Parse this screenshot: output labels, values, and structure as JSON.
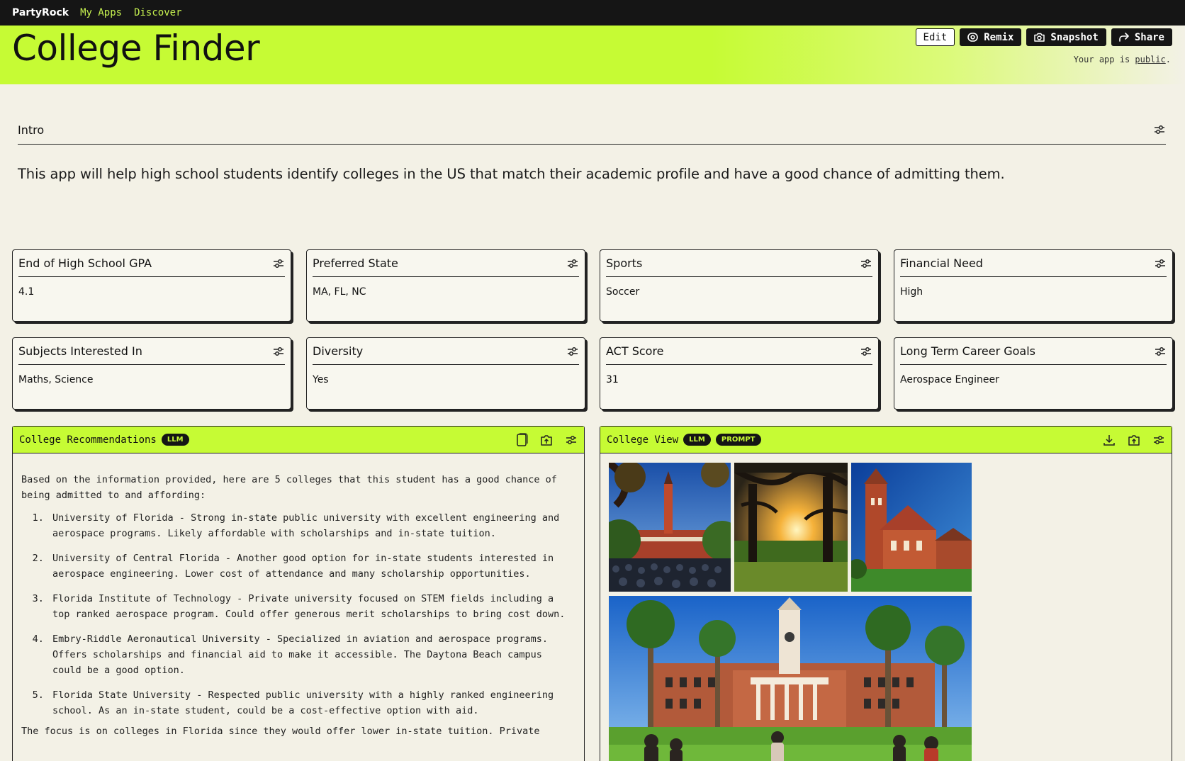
{
  "nav": {
    "brand": "PartyRock",
    "links": [
      "My Apps",
      "Discover"
    ]
  },
  "header": {
    "title": "College Finder",
    "actions": {
      "edit": "Edit",
      "remix": "Remix",
      "snapshot": "Snapshot",
      "share": "Share"
    },
    "public_prefix": "Your app is ",
    "public_link": "public",
    "public_suffix": "."
  },
  "intro": {
    "label": "Intro",
    "text": "This app will help high school students identify colleges in the US that match their academic profile and have a good chance of admitting them."
  },
  "inputs": [
    {
      "label": "End of High School GPA",
      "value": "4.1"
    },
    {
      "label": "Preferred State",
      "value": "MA, FL, NC"
    },
    {
      "label": "Sports",
      "value": "Soccer"
    },
    {
      "label": "Financial Need",
      "value": "High"
    },
    {
      "label": "Subjects Interested In",
      "value": "Maths, Science"
    },
    {
      "label": "Diversity",
      "value": "Yes"
    },
    {
      "label": "ACT Score",
      "value": "31"
    },
    {
      "label": "Long Term Career Goals",
      "value": "Aerospace Engineer"
    }
  ],
  "recommendations": {
    "title": "College Recommendations",
    "badge": "LLM",
    "intro": "Based on the information provided, here are 5 colleges that this student has a good chance of being admitted to and affording:",
    "items": [
      "University of Florida - Strong in-state public university with excellent engineering and aerospace programs. Likely affordable with scholarships and in-state tuition.",
      "University of Central Florida - Another good option for in-state students interested in aerospace engineering. Lower cost of attendance and many scholarship opportunities.",
      "Florida Institute of Technology - Private university focused on STEM fields including a top ranked aerospace program. Could offer generous merit scholarships to bring cost down.",
      "Embry-Riddle Aeronautical University - Specialized in aviation and aerospace programs. Offers scholarships and financial aid to make it accessible. The Daytona Beach campus could be a good option.",
      "Florida State University - Respected public university with a highly ranked engineering school. As an in-state student, could be a cost-effective option with aid."
    ],
    "outro": "The focus is on colleges in Florida since they would offer lower in-state tuition. Private"
  },
  "college_view": {
    "title": "College View",
    "badges": [
      "LLM",
      "PROMPT"
    ]
  }
}
